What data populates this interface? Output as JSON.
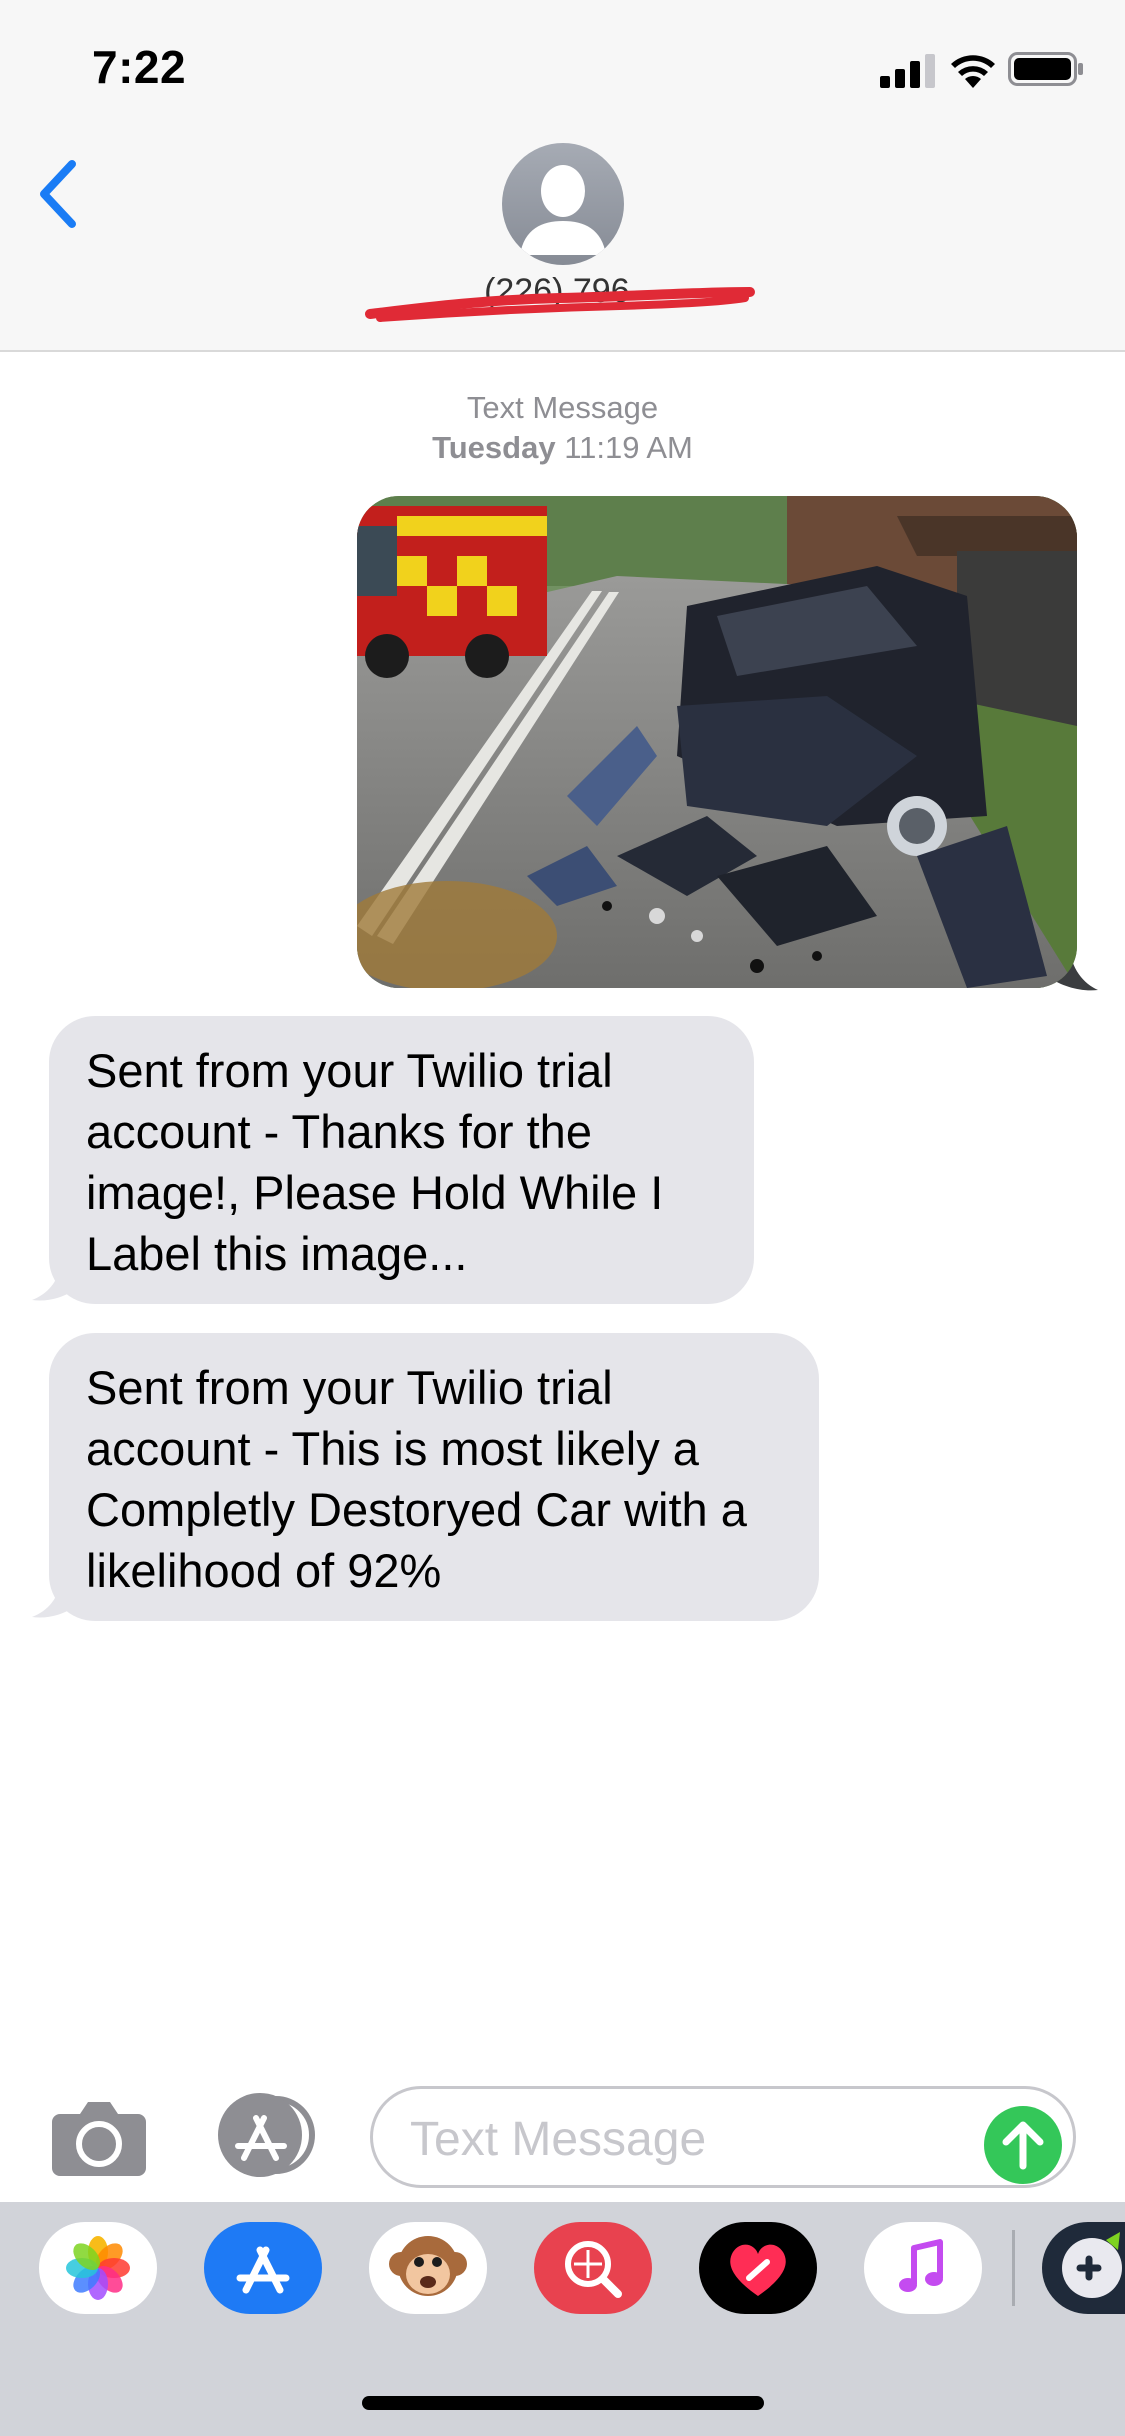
{
  "status_bar": {
    "time": "7:22"
  },
  "header": {
    "contact": "(226) 796-"
  },
  "thread": {
    "meta_label": "Text Message",
    "day": "Tuesday",
    "time": "11:19 AM"
  },
  "messages": [
    {
      "from": "me",
      "type": "image"
    },
    {
      "from": "them",
      "text": "Sent from your Twilio trial account - Thanks for the image!, Please Hold While I Label this image..."
    },
    {
      "from": "them",
      "text": "Sent from your Twilio trial account - This is most likely a Completly Destoryed Car with a likelihood of 92%"
    }
  ],
  "composer": {
    "placeholder": "Text Message"
  },
  "app_drawer": [
    "photos-icon",
    "app-store-icon",
    "animoji-icon",
    "image-search-icon",
    "digital-touch-icon",
    "music-icon",
    "game-icon"
  ],
  "colors": {
    "accent_blue": "#1a7cf5",
    "send_green": "#34c759",
    "incoming_bubble": "#e5e5ea"
  }
}
